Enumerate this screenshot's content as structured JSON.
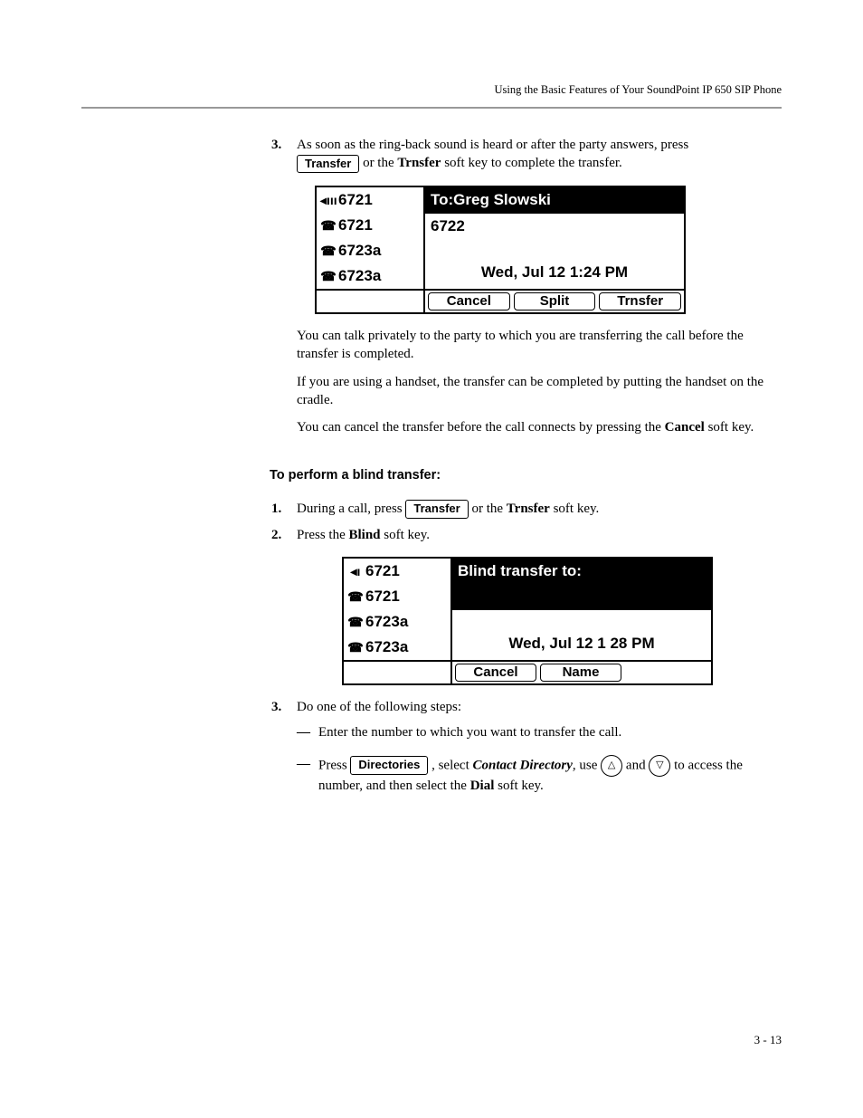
{
  "runningHead": "Using the Basic Features of Your SoundPoint IP 650 SIP Phone",
  "step3a": {
    "num": "3.",
    "pre": "As soon as the ring-back sound is heard or after the party answers, press ",
    "key": "Transfer",
    "mid": " or the ",
    "soft": "Trnsfer",
    "post": " soft key to complete the transfer."
  },
  "lcd1": {
    "lines": [
      {
        "icon": "◂ııı",
        "label": "6721"
      },
      {
        "icon": "☎",
        "label": "6721"
      },
      {
        "icon": "☎",
        "label": "6723a"
      },
      {
        "icon": "☎",
        "label": "6723a"
      }
    ],
    "title": "To:Greg Slowski",
    "sub": "6722",
    "date": "Wed, Jul 12  1:24 PM",
    "softkeys": [
      "Cancel",
      "Split",
      "Trnsfer"
    ]
  },
  "para1_a": "You can talk privately to the party to which you are transferring the call before the transfer is completed.",
  "para1_b": "If you are using a handset, the transfer can be completed by putting the handset on the cradle.",
  "para1_c_pre": "You can cancel the transfer before the call connects by pressing the ",
  "para1_c_soft": "Cancel",
  "para1_c_post": " soft key.",
  "sectionHead": "To perform a blind transfer:",
  "bstep1": {
    "num": "1.",
    "pre": "During a call, press ",
    "key": "Transfer",
    "mid": " or the ",
    "soft": "Trnsfer",
    "post": " soft key."
  },
  "bstep2": {
    "num": "2.",
    "pre": "Press the ",
    "soft": "Blind",
    "post": " soft key."
  },
  "lcd2": {
    "lines": [
      {
        "icon": "◂ı",
        "label": "6721"
      },
      {
        "icon": "☎",
        "label": "6721"
      },
      {
        "icon": "☎",
        "label": "6723a"
      },
      {
        "icon": "☎",
        "label": "6723a"
      }
    ],
    "title": "Blind transfer to:",
    "date": "Wed, Jul 12  1 28 PM",
    "softkeys": [
      "Cancel",
      "Name"
    ]
  },
  "bstep3": {
    "num": "3.",
    "text": "Do one of the following steps:",
    "subA": "Enter the number to which you want to transfer the call.",
    "subB_pre": "Press ",
    "subB_key": "Directories",
    "subB_mid1": " , select ",
    "subB_ital": "Contact Directory",
    "subB_mid2": ", use ",
    "subB_and": " and ",
    "subB_mid3": " to access the number, and then select the ",
    "subB_soft": "Dial",
    "subB_post": " soft key."
  },
  "footer": "3 - 13"
}
